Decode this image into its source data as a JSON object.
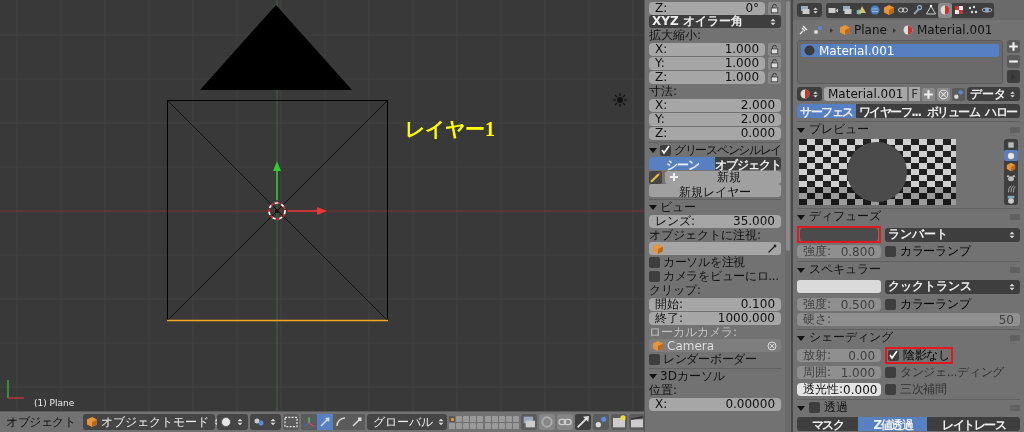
{
  "viewport": {
    "annotation": "レイヤー1",
    "object_info": "(1) Plane"
  },
  "header": {
    "menu": "オブジェクト",
    "mode": "オブジェクトモード",
    "orientation": "グローバル",
    "manipulators": [
      {
        "kind": "axes",
        "selected": false
      },
      {
        "kind": "translate",
        "selected": true
      },
      {
        "kind": "rotate",
        "selected": false
      },
      {
        "kind": "scale",
        "selected": false
      }
    ],
    "layers": [
      {
        "selected": true
      },
      {
        "selected": false
      },
      {
        "selected": false
      },
      {
        "selected": false
      },
      {
        "selected": false
      },
      {
        "selected": false
      },
      {
        "selected": false
      },
      {
        "selected": false
      },
      {
        "selected": false
      },
      {
        "selected": false
      },
      {
        "selected": false
      },
      {
        "selected": false
      },
      {
        "selected": false
      },
      {
        "selected": false
      },
      {
        "selected": false
      },
      {
        "selected": false
      },
      {
        "selected": false
      },
      {
        "selected": false
      },
      {
        "selected": false
      },
      {
        "selected": false
      }
    ]
  },
  "n_panel": {
    "rows": [
      {
        "kind": "field",
        "label": "Z:",
        "value": "0°",
        "lock": true
      },
      {
        "kind": "dropdown",
        "value": "XYZ オイラー角"
      },
      {
        "kind": "label",
        "text": "拡大縮小:",
        "disabled": false
      },
      {
        "kind": "field",
        "label": "X:",
        "value": "1.000",
        "lock": true
      },
      {
        "kind": "field",
        "label": "Y:",
        "value": "1.000",
        "lock": true
      },
      {
        "kind": "field",
        "label": "Z:",
        "value": "1.000",
        "lock": true
      },
      {
        "kind": "label",
        "text": "寸法:",
        "disabled": false
      },
      {
        "kind": "field",
        "label": "X:",
        "value": "2.000",
        "lock": false
      },
      {
        "kind": "field",
        "label": "Y:",
        "value": "2.000",
        "lock": false
      },
      {
        "kind": "field",
        "label": "Z:",
        "value": "0.000",
        "lock": false
      },
      {
        "kind": "section_check",
        "title": "グリースペンシルレイ",
        "expanded": true,
        "checked": true
      },
      {
        "kind": "toggle",
        "options": [
          {
            "label": "シーン",
            "selected": true
          },
          {
            "label": "オブジェクト",
            "selected": false
          }
        ]
      },
      {
        "kind": "new",
        "label": "新規"
      },
      {
        "kind": "button",
        "label": "新規レイヤー"
      },
      {
        "kind": "section",
        "title": "ビュー",
        "expanded": true
      },
      {
        "kind": "field",
        "label": "レンズ:",
        "value": "35.000",
        "lock": false
      },
      {
        "kind": "label",
        "text": "オブジェクトに注視:",
        "disabled": false
      },
      {
        "kind": "picker",
        "disabled": false
      },
      {
        "kind": "checkbox",
        "label": "カーソルを注視",
        "checked": false
      },
      {
        "kind": "checkbox",
        "label": "カメラをビューにロ...",
        "checked": false
      },
      {
        "kind": "label",
        "text": "クリップ:",
        "disabled": false
      },
      {
        "kind": "field",
        "label": "開始:",
        "value": "0.100",
        "lock": false
      },
      {
        "kind": "field",
        "label": "終了:",
        "value": "1000.000",
        "lock": false
      },
      {
        "kind": "label",
        "text": "ローカルカメラ:",
        "disabled": true
      },
      {
        "kind": "picker",
        "value": "Camera",
        "disabled": true
      },
      {
        "kind": "checkbox",
        "label": "レンダーボーダー",
        "checked": false
      },
      {
        "kind": "section",
        "title": "3Dカーソル",
        "expanded": true
      },
      {
        "kind": "label",
        "text": "位置:",
        "disabled": false
      },
      {
        "kind": "field",
        "label": "X:",
        "value": "0.00000",
        "lock": false
      }
    ]
  },
  "properties": {
    "context_tabs": [
      {
        "kind": "camera",
        "selected": false
      },
      {
        "kind": "layers",
        "selected": false
      },
      {
        "kind": "scene",
        "selected": false
      },
      {
        "kind": "globe",
        "selected": false
      },
      {
        "kind": "cube",
        "selected": false
      },
      {
        "kind": "chain",
        "selected": false
      },
      {
        "kind": "wrench",
        "selected": false
      },
      {
        "kind": "mesh",
        "selected": false
      },
      {
        "kind": "material",
        "selected": true
      },
      {
        "kind": "checker",
        "selected": false
      },
      {
        "kind": "particles",
        "selected": false
      },
      {
        "kind": "physics",
        "selected": false
      }
    ],
    "breadcrumb": [
      {
        "kind": "cube",
        "label": "Plane"
      },
      {
        "kind": "material",
        "label": "Material.001"
      }
    ],
    "slots": [
      {
        "name": "Material.001",
        "selected": true
      }
    ],
    "datablock": {
      "name": "Material.001",
      "fake_user": "F",
      "link": "データ"
    },
    "tabs": [
      {
        "label": "サーフェス",
        "selected": true
      },
      {
        "label": "ワイヤーフ...",
        "selected": false
      },
      {
        "label": "ボリューム",
        "selected": false
      },
      {
        "label": "ハロー",
        "selected": false
      }
    ],
    "sections": [
      {
        "kind": "preview",
        "title": "プレビュー",
        "expanded": true,
        "shapes": [
          {
            "kind": "plane",
            "selected": false
          },
          {
            "kind": "sphere",
            "selected": true
          },
          {
            "kind": "cube",
            "selected": false
          },
          {
            "kind": "head",
            "selected": false
          },
          {
            "kind": "hair",
            "selected": false
          },
          {
            "kind": "sky",
            "selected": false
          }
        ]
      },
      {
        "kind": "color",
        "title": "ディフューズ",
        "expanded": true,
        "color": "#4b4b4b",
        "annotated": true,
        "shader": "ランバート",
        "intensity": {
          "label": "強度:",
          "value": "0.800"
        },
        "ramp": {
          "label": "カラーランプ",
          "checked": false
        }
      },
      {
        "kind": "color",
        "title": "スペキュラー",
        "expanded": true,
        "color": "#dadada",
        "annotated": false,
        "shader": "クックトランス",
        "intensity": {
          "label": "強度:",
          "value": "0.500"
        },
        "ramp": {
          "label": "カラーランプ",
          "checked": false
        },
        "hardness": {
          "label": "硬さ:",
          "value": "50"
        }
      },
      {
        "kind": "shading",
        "title": "シェーディング",
        "expanded": true,
        "fields": [
          {
            "label": "放射:",
            "value": "0.00",
            "disabled": true,
            "active": false
          },
          {
            "label": "周囲:",
            "value": "1.000",
            "disabled": true,
            "active": false
          },
          {
            "label": "透光性:",
            "value": "0.000",
            "disabled": false,
            "active": true
          }
        ],
        "options": [
          {
            "label": "陰影なし",
            "checked": true,
            "disabled": false,
            "annotated": true
          },
          {
            "label": "タンジェ...ディング",
            "checked": false,
            "disabled": true,
            "annotated": false
          },
          {
            "label": "三次補間",
            "checked": false,
            "disabled": true,
            "annotated": false
          }
        ]
      },
      {
        "kind": "toggle_section",
        "title": "透過",
        "expanded": true,
        "checked": false,
        "modes": [
          {
            "label": "マスク",
            "selected": false
          },
          {
            "label": "Z値透過",
            "selected": true
          },
          {
            "label": "レイトレース",
            "selected": false
          }
        ]
      }
    ]
  }
}
